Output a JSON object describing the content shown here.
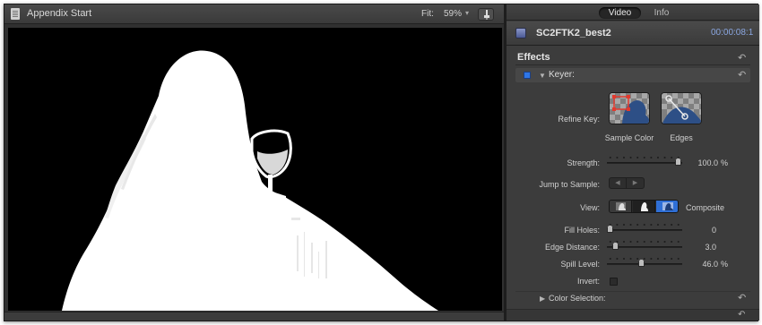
{
  "viewer": {
    "title": "Appendix Start",
    "fit_label": "Fit:",
    "fit_value": "59%",
    "fit_chevron": "▾",
    "icons": {
      "document": "document-icon",
      "view_options": "view-options-icon"
    }
  },
  "inspector": {
    "tabs": {
      "video": "Video",
      "info": "Info"
    },
    "clip_name": "SC2FTK2_best2",
    "clip_timecode": "00:00:08:1",
    "effects_title": "Effects",
    "reset_glyph": "↶",
    "keyer": {
      "label": "Keyer:",
      "disclosure": "▼",
      "refine_key_label": "Refine Key:",
      "sample_color_label": "Sample Color",
      "edges_label": "Edges",
      "strength": {
        "label": "Strength:",
        "value": "100.0",
        "unit": "%",
        "fraction": 1.0
      },
      "jump_to_sample": {
        "label": "Jump to Sample:",
        "prev": "◀",
        "next": "▶"
      },
      "view": {
        "label": "View:",
        "value": "Composite",
        "options": [
          "matte",
          "original",
          "composite"
        ],
        "selected": "composite"
      },
      "fill_holes": {
        "label": "Fill Holes:",
        "value": "0",
        "fraction": 0.0
      },
      "edge_distance": {
        "label": "Edge Distance:",
        "value": "3.0",
        "fraction": 0.08
      },
      "spill_level": {
        "label": "Spill Level:",
        "value": "46.0",
        "unit": "%",
        "fraction": 0.46
      },
      "invert": {
        "label": "Invert:",
        "checked": false
      },
      "color_selection": {
        "label": "Color Selection:",
        "disclosure": "▶"
      }
    },
    "colors": {
      "accent": "#2f76e6",
      "timecode": "#8aa6e0"
    }
  }
}
